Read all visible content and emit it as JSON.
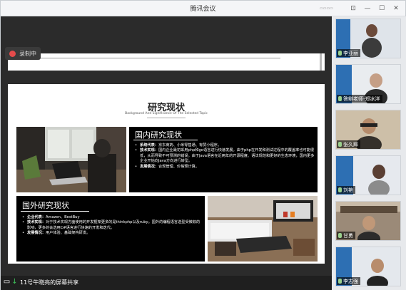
{
  "window": {
    "title": "腾讯会议"
  },
  "recording": {
    "label": "录制中"
  },
  "slide": {
    "title": "研究现状",
    "subtitle": "Background And Significance Of The Selected Topic",
    "domestic": {
      "heading": "国内研究现状",
      "bullets": [
        {
          "label": "系统代表：",
          "text": "京东商药、小米零售通、有赞小程序。"
        },
        {
          "label": "技术实现：",
          "text": "国内企业最初采用php和go语言进行快速发展。由于php在开发和测试过程中的覆盖率也可能很低，从而导致不可预测的错误。由于Java语言在近两年的开源程度、语法规范和更好的生态环境，国内更多企业开始向Java方向进行转型。"
        },
        {
          "label": "发展情况：",
          "text": "合规管理、价格预计算。"
        }
      ]
    },
    "foreign": {
      "heading": "国外研究现状",
      "bullets": [
        {
          "label": "企业代表：",
          "text": "Amazon、BestBuy"
        },
        {
          "label": "技术实现：",
          "text": "对于技术实现方面使用的开发框架更多的是thinkphp以及ruby。国外的编程语言选型受微软的影响，更多的会选用C#语言进行快速的开发和迭代。"
        },
        {
          "label": "发展情况：",
          "text": "用户体验、基础架构研发。"
        }
      ]
    }
  },
  "share_bar": {
    "text": "11号牛晓亮的屏幕共享"
  },
  "participants": [
    {
      "name": "李亚丽"
    },
    {
      "name": "答辩老师-郑冰洋"
    },
    {
      "name": "张久辉"
    },
    {
      "name": "刘艳"
    },
    {
      "name": "甘勇"
    },
    {
      "name": "李志强"
    }
  ],
  "colors": {
    "accent_record": "#e54b4b",
    "share_green": "#3ec45a",
    "slide_box": "#000000"
  }
}
